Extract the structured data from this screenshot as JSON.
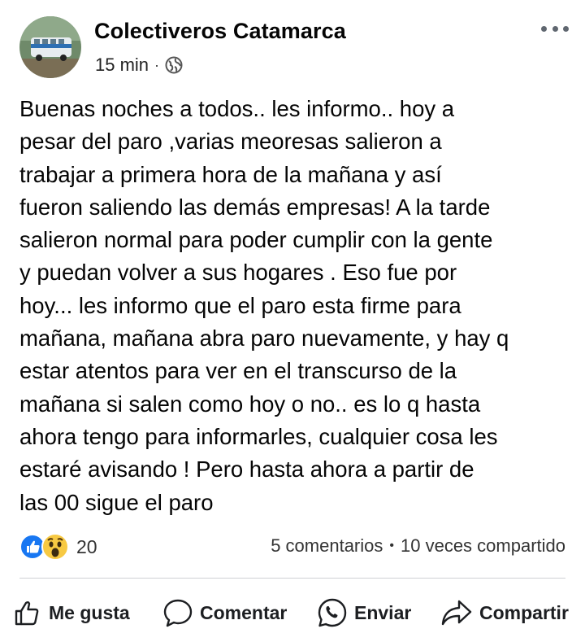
{
  "post": {
    "author": "Colectiveros Catamarca",
    "timestamp": "15 min",
    "separator": "·",
    "privacy_icon": "globe-icon",
    "more_icon": "more-options-icon",
    "text": "Buenas noches a todos.. les informo.. hoy a\npesar del paro ,varias meoresas salieron a\ntrabajar a primera hora de la mañana y así\nfueron saliendo las demás empresas! A la tarde\nsalieron normal para poder cumplir con la gente\ny puedan volver a sus hogares . Eso fue por\nhoy... les informo que el paro esta firme para\nmañana, mañana abra paro nuevamente, y hay q\nestar atentos para ver en el transcurso de la\nmañana si salen como hoy o no.. es lo q hasta\nahora tengo para informarles, cualquier cosa les\nestaré avisando ! Pero hasta ahora a partir de\nlas 00 sigue el paro"
  },
  "engagement": {
    "reaction_icons": [
      "like-reaction-icon",
      "wow-reaction-icon"
    ],
    "reaction_count": "20",
    "comments": "5 comentarios",
    "separator": "•",
    "shares": "10 veces compartido"
  },
  "actions": {
    "like": "Me gusta",
    "comment": "Comentar",
    "send": "Enviar",
    "share": "Compartir"
  },
  "colors": {
    "like_blue": "#1877f2",
    "wow_yellow": "#f7c943",
    "icon_gray": "#606770",
    "divider": "#ced0d4"
  }
}
